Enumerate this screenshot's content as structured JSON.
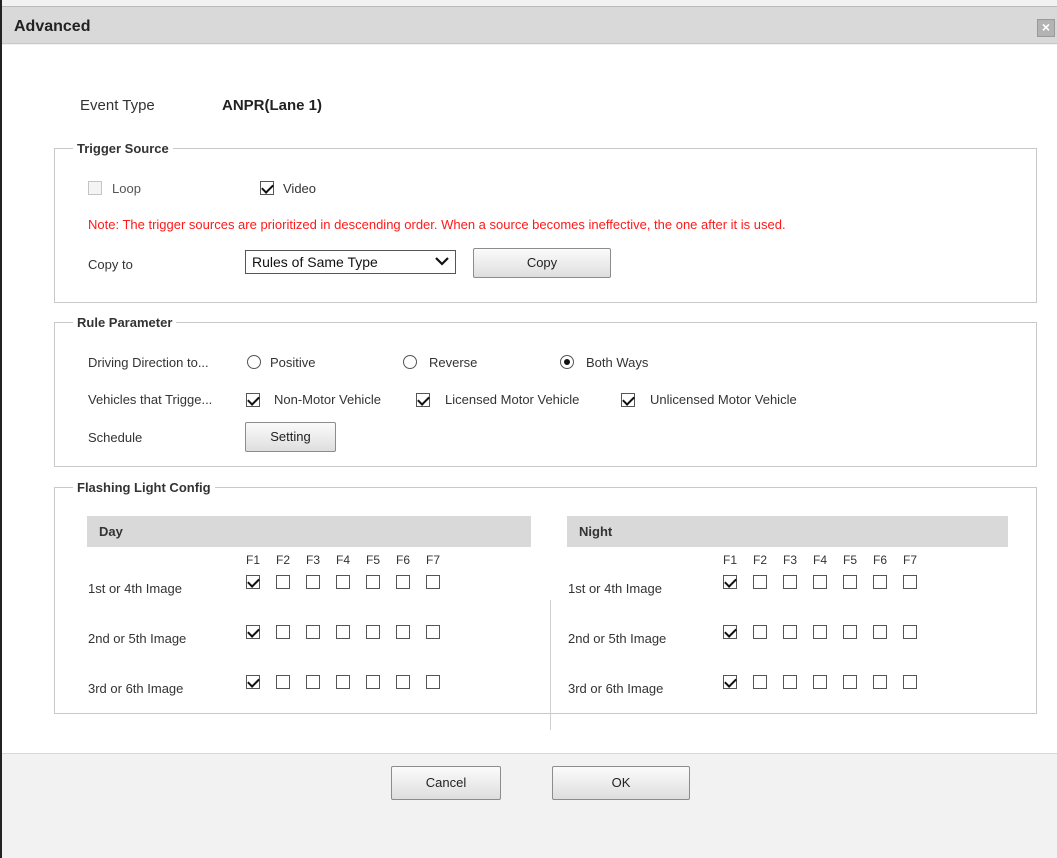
{
  "window": {
    "title": "Advanced",
    "close_glyph": "×"
  },
  "event": {
    "label": "Event Type",
    "value": "ANPR(Lane 1)"
  },
  "trigger_source": {
    "legend": "Trigger Source",
    "loop": {
      "label": "Loop",
      "checked": false,
      "disabled": true
    },
    "video": {
      "label": "Video",
      "checked": true
    },
    "note": "Note: The trigger sources are prioritized in descending order. When a source becomes ineffective, the one after it is used.",
    "copy_to_label": "Copy to",
    "copy_select_value": "Rules of Same Type",
    "copy_button": "Copy"
  },
  "rule_parameter": {
    "legend": "Rule Parameter",
    "direction_label": "Driving Direction to...",
    "directions": [
      {
        "label": "Positive",
        "checked": false
      },
      {
        "label": "Reverse",
        "checked": false
      },
      {
        "label": "Both Ways",
        "checked": true
      }
    ],
    "vehicles_label": "Vehicles that Trigge...",
    "vehicles": [
      {
        "label": "Non-Motor Vehicle",
        "checked": true
      },
      {
        "label": "Licensed Motor Vehicle",
        "checked": true
      },
      {
        "label": "Unlicensed Motor Vehicle",
        "checked": true
      }
    ],
    "schedule_label": "Schedule",
    "setting_button": "Setting"
  },
  "flashing_light": {
    "legend": "Flashing Light Config",
    "columns": [
      "F1",
      "F2",
      "F3",
      "F4",
      "F5",
      "F6",
      "F7"
    ],
    "day": {
      "title": "Day",
      "rows": [
        {
          "label": "1st or 4th Image",
          "checks": [
            true,
            false,
            false,
            false,
            false,
            false,
            false
          ]
        },
        {
          "label": "2nd or 5th Image",
          "checks": [
            true,
            false,
            false,
            false,
            false,
            false,
            false
          ]
        },
        {
          "label": "3rd or 6th Image",
          "checks": [
            true,
            false,
            false,
            false,
            false,
            false,
            false
          ]
        }
      ]
    },
    "night": {
      "title": "Night",
      "rows": [
        {
          "label": "1st or 4th Image",
          "checks": [
            true,
            false,
            false,
            false,
            false,
            false,
            false
          ]
        },
        {
          "label": "2nd or 5th Image",
          "checks": [
            true,
            false,
            false,
            false,
            false,
            false,
            false
          ]
        },
        {
          "label": "3rd or 6th Image",
          "checks": [
            true,
            false,
            false,
            false,
            false,
            false,
            false
          ]
        }
      ]
    }
  },
  "footer": {
    "cancel": "Cancel",
    "ok": "OK"
  }
}
